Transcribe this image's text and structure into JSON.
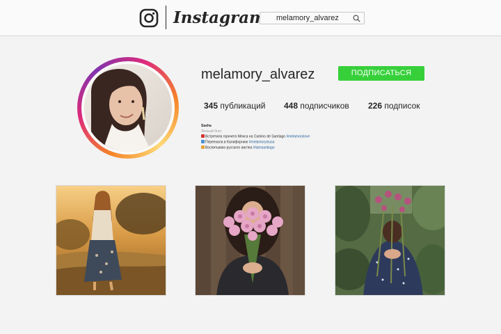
{
  "header": {
    "brand": "Instagram",
    "search_value": "melamory_alvarez",
    "icons": [
      "instagram-logo-icon",
      "search-icon"
    ]
  },
  "profile": {
    "username": "melamory_alvarez",
    "follow_label": "ПОДПИСАТЬСЯ",
    "stats": [
      {
        "count": "345",
        "label": "публикаций"
      },
      {
        "count": "448",
        "label": "подписчиков"
      },
      {
        "count": "226",
        "label": "подписок"
      }
    ],
    "bio": {
      "name": "Sasha",
      "subtitle": "Личный блог",
      "lines": [
        {
          "text": "Встретила горячего Мексa на Camino de Santiago ",
          "tag": "#melamorylove"
        },
        {
          "text": "Переехала в Калифорнию ",
          "tag": "#melamoryinusa"
        },
        {
          "text": "Воспитываю русского аиглеа ",
          "tag": "#liamsantiago"
        }
      ]
    }
  },
  "colors": {
    "follow_button": "#37d03b",
    "hashtag": "#1e5a96",
    "story_ring": [
      "#f58529",
      "#dd2a7b",
      "#8134af"
    ]
  },
  "posts": [
    {
      "subject": "woman in floral skirt in golden field"
    },
    {
      "subject": "woman holding pink flower bouquet against wooden wall"
    },
    {
      "subject": "woman in blue floral dress holding bouquet in garden"
    }
  ]
}
